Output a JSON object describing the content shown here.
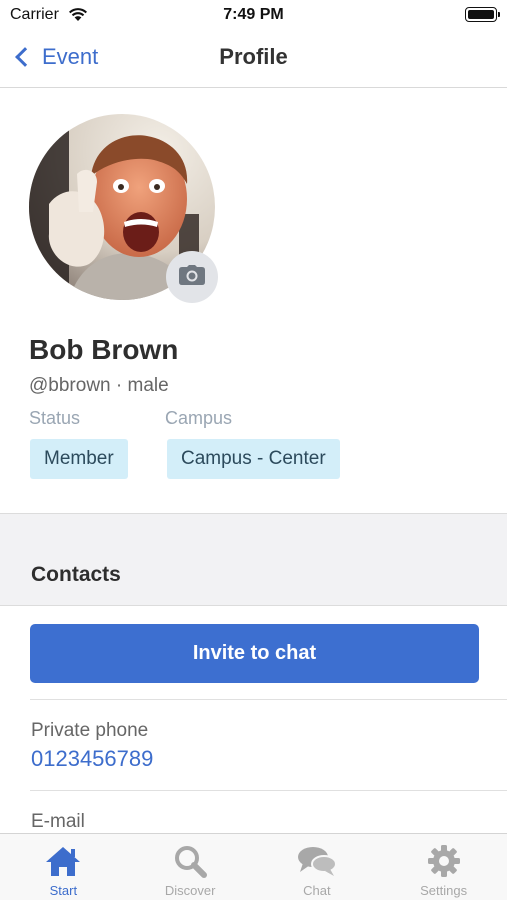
{
  "status_bar": {
    "carrier": "Carrier",
    "time": "7:49 PM"
  },
  "nav": {
    "back_label": "Event",
    "title": "Profile"
  },
  "profile": {
    "name": "Bob Brown",
    "handle_line": "@bbrown · male",
    "status_label": "Status",
    "status_value": "Member",
    "campus_label": "Campus",
    "campus_value": "Campus - Center"
  },
  "contacts": {
    "title": "Contacts",
    "invite_label": "Invite to chat",
    "fields": [
      {
        "label": "Private phone",
        "value": "0123456789"
      },
      {
        "label": "E-mail",
        "value": ""
      }
    ]
  },
  "tabs": [
    {
      "label": "Start",
      "icon": "home-icon",
      "active": true
    },
    {
      "label": "Discover",
      "icon": "search-icon",
      "active": false
    },
    {
      "label": "Chat",
      "icon": "chat-icon",
      "active": false
    },
    {
      "label": "Settings",
      "icon": "gear-icon",
      "active": false
    }
  ],
  "colors": {
    "accent": "#3d6dcc",
    "tag_bg": "#d3eef9",
    "inactive": "#a8a8a8"
  }
}
